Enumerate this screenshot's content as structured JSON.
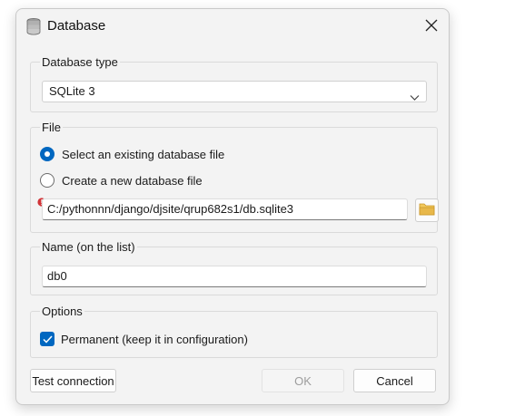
{
  "dialog": {
    "title": "Database",
    "icon": "database-icon",
    "close_icon": "close-icon"
  },
  "database_type": {
    "group_title": "Database type",
    "selected_value": "SQLite 3"
  },
  "file": {
    "group_title": "File",
    "option_existing": "Select an existing database file",
    "option_new": "Create a new database file",
    "selected_option": "existing",
    "path_value": "C:/pythonnn/django/djsite/qrup682s1/db.sqlite3",
    "browse_icon": "folder-icon",
    "status_icon": "error-icon"
  },
  "name": {
    "group_title": "Name (on the list)",
    "value": "db0"
  },
  "options": {
    "group_title": "Options",
    "permanent_label": "Permanent (keep it in configuration)",
    "permanent_checked": true
  },
  "buttons": {
    "test_connection": "Test connection",
    "ok": "OK",
    "ok_enabled": false,
    "cancel": "Cancel"
  },
  "colors": {
    "accent": "#0067c0",
    "error": "#d13438",
    "folder": "#e8b84a"
  }
}
